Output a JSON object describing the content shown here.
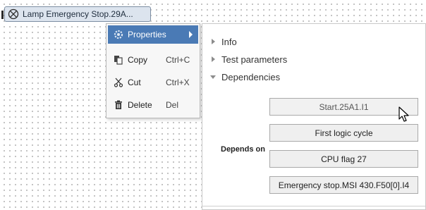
{
  "canvas_block": {
    "label": "Lamp Emergency Stop.29A...",
    "icon": "lamp-icon"
  },
  "context_menu": {
    "items": [
      {
        "label": "Properties",
        "shortcut": "",
        "icon": "properties-icon",
        "highlighted": true,
        "has_submenu": true
      },
      {
        "label": "Copy",
        "shortcut": "Ctrl+C",
        "icon": "copy-icon"
      },
      {
        "label": "Cut",
        "shortcut": "Ctrl+X",
        "icon": "cut-icon"
      },
      {
        "label": "Delete",
        "shortcut": "Del",
        "icon": "delete-icon"
      }
    ]
  },
  "properties_panel": {
    "sections": [
      {
        "label": "Info",
        "expanded": false
      },
      {
        "label": "Test parameters",
        "expanded": false
      },
      {
        "label": "Dependencies",
        "expanded": true
      }
    ],
    "depends_on_label": "Depends on",
    "dependencies": [
      "Start.25A1.I1",
      "First logic cycle",
      "CPU flag 27",
      "Emergency stop.MSI 430.F50[0].I4"
    ]
  },
  "colors": {
    "menu_highlight": "#4a7ab5",
    "block_fill": "#dce4ee",
    "block_border": "#7d8ea3"
  }
}
